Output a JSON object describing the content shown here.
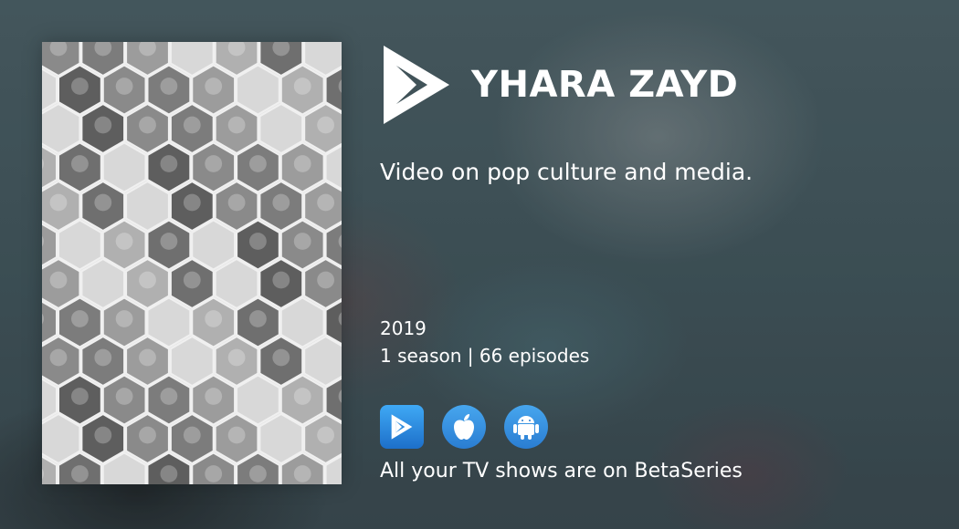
{
  "show": {
    "title": "YHARA ZAYD",
    "description": "Video on pop culture and media.",
    "year": "2019",
    "meta": "1 season | 66 episodes"
  },
  "apps": [
    {
      "name": "betaseries-app-icon"
    },
    {
      "name": "apple-icon"
    },
    {
      "name": "android-icon"
    }
  ],
  "footer": {
    "tagline": "All your TV shows are on BetaSeries"
  },
  "colors": {
    "app_badge": "#2a8ae0",
    "text": "#ffffff",
    "poster_bg": "#e6e6e6"
  }
}
